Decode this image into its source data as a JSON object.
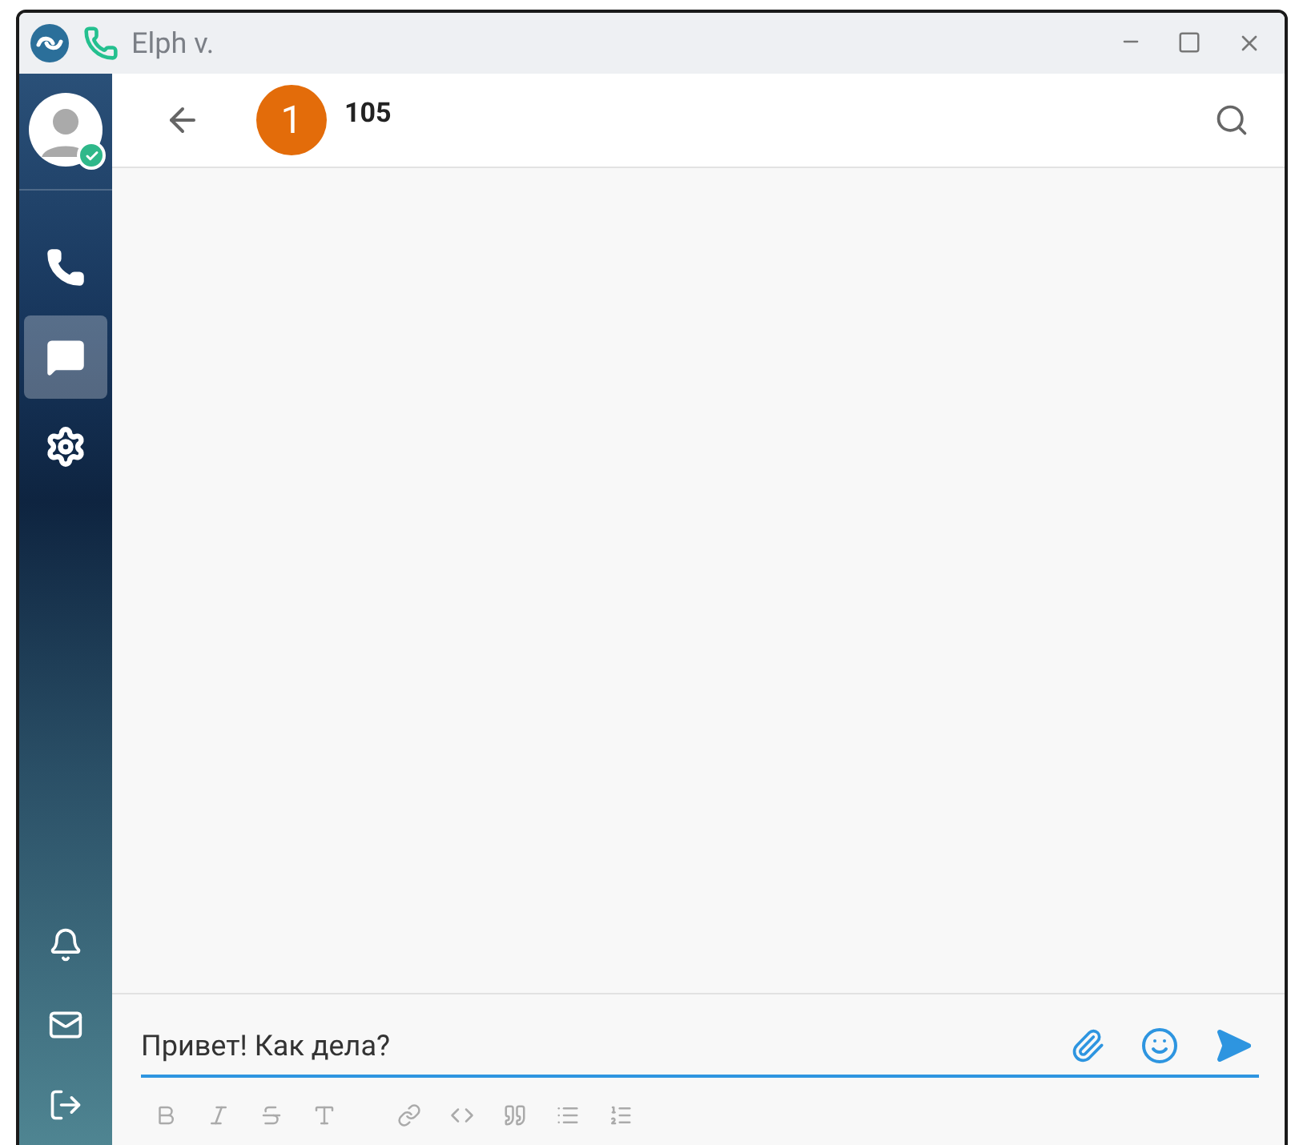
{
  "window": {
    "title": "Elph v."
  },
  "user": {
    "online": true
  },
  "nav_items": [
    {
      "kind": "phone",
      "selected": false
    },
    {
      "kind": "chat",
      "selected": true
    },
    {
      "kind": "settings",
      "selected": false
    }
  ],
  "bottom_items": [
    {
      "kind": "bell"
    },
    {
      "kind": "mail"
    },
    {
      "kind": "logout"
    }
  ],
  "header": {
    "badge": "1",
    "contact": "105"
  },
  "composer": {
    "value": "Привет! Как дела?"
  }
}
